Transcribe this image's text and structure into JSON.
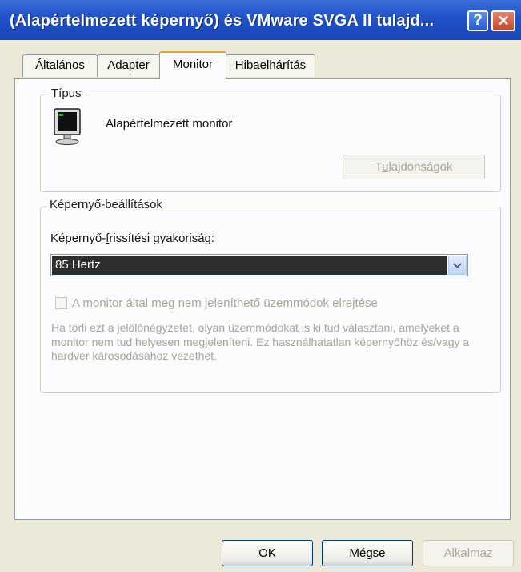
{
  "window": {
    "title": "(Alapértelmezett képernyő) és VMware SVGA II tulajd...",
    "help_glyph": "?",
    "close_glyph": "✕"
  },
  "tabs": [
    {
      "label": "Általános",
      "active": false
    },
    {
      "label": "Adapter",
      "active": false
    },
    {
      "label": "Monitor",
      "active": true
    },
    {
      "label": "Hibaelhárítás",
      "active": false
    }
  ],
  "monitor_type": {
    "legend": "Típus",
    "icon": "monitor-icon",
    "name": "Alapértelmezett monitor",
    "properties_button": {
      "label_prefix": "T",
      "label_access": "u",
      "label_rest": "lajdonságok",
      "enabled": false
    }
  },
  "display_settings": {
    "legend": "Képernyő-beállítások",
    "refresh_label_prefix": "Képernyő-",
    "refresh_label_access": "f",
    "refresh_label_rest": "rissítési gyakoriság:",
    "refresh_value": "85 Hertz",
    "hide_modes_checkbox": {
      "checked": false,
      "enabled": false,
      "label_prefix": "A ",
      "label_access": "m",
      "label_rest": "onitor által meg nem jeleníthető üzemmódok elrejtése"
    },
    "warning_text": "Ha törli ezt a jelölőnégyzetet, olyan üzemmódokat is ki tud választani, amelyeket a monitor nem tud helyesen megjeleníteni. Ez használhatatlan képernyőhöz és/vagy a hardver károsodásához vezethet."
  },
  "buttons": {
    "ok": "OK",
    "cancel": "Mégse",
    "apply_prefix": "Alkalma",
    "apply_access": "z",
    "apply_enabled": false
  },
  "colors": {
    "titlebar": "#2150c8",
    "dialog_bg": "#ece9d8",
    "active_tab_accent": "#e8a33b",
    "selection_bg": "#2e2e2e"
  }
}
